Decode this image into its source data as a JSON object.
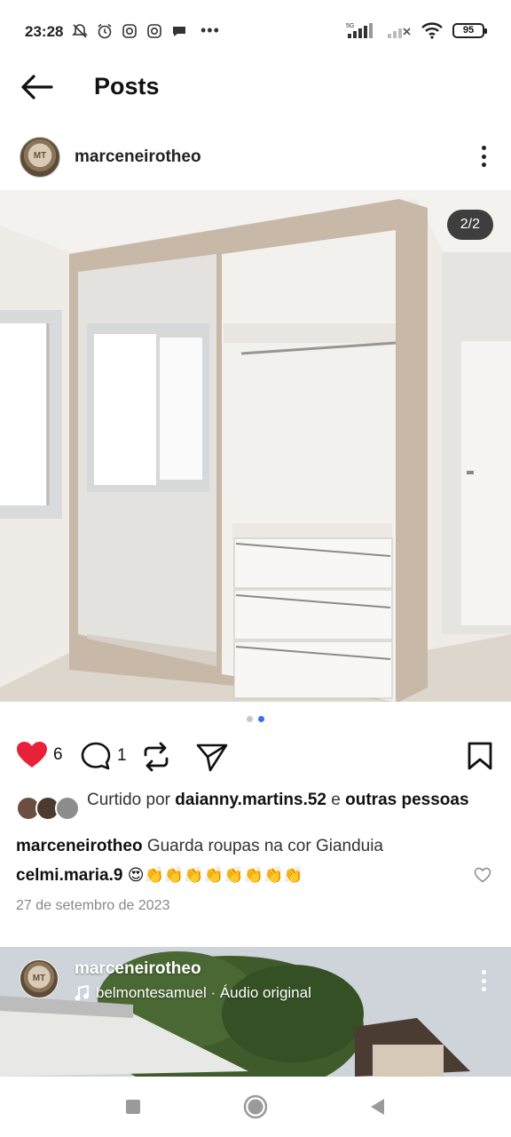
{
  "status_bar": {
    "time": "23:28",
    "network": "5G",
    "battery": "95",
    "icons": [
      "mute-notifications-icon",
      "alarm-icon",
      "instagram-icon",
      "instagram-icon",
      "chat-icon",
      "more-dots-icon",
      "signal-icon",
      "signal-icon",
      "wifi-icon",
      "battery-icon"
    ]
  },
  "header": {
    "title": "Posts",
    "back_icon": "arrow-left-icon"
  },
  "post": {
    "username": "marceneirotheo",
    "avatar_text": "MT",
    "media_counter": "2/2",
    "carousel": {
      "total": 2,
      "current": 2
    },
    "likes_count": "6",
    "comments_count": "1",
    "liked_by_prefix": "Curtido por",
    "liked_by_user": "daianny.martins.52",
    "liked_by_connector": "e",
    "liked_by_suffix": "outras pessoas",
    "caption_user": "marceneirotheo",
    "caption_text": "Guarda roupas na cor Gianduia",
    "comment_user": "celmi.maria.9",
    "comment_text": "😍👏👏👏👏👏👏👏👏",
    "date": "27 de setembro de 2023",
    "colors": {
      "like": "#e8203a",
      "dot_active": "#3b6ee8"
    }
  },
  "next_post": {
    "username": "marceneirotheo",
    "audio": "belmontesamuel · Áudio original",
    "avatar_text": "MT"
  },
  "nav": {
    "icons": [
      "recents-square-icon",
      "home-circle-icon",
      "back-triangle-icon"
    ]
  }
}
